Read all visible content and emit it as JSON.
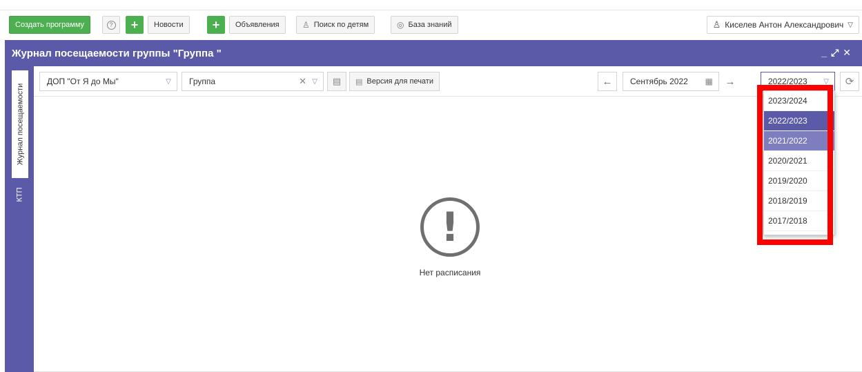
{
  "toolbar": {
    "create_program": "Создать программу",
    "help_icon": "?",
    "news": "Новости",
    "announcements": "Объявления",
    "child_search": "Поиск по детям",
    "knowledge_base": "База знаний",
    "user_name": "Киселев Антон Александрович"
  },
  "window": {
    "title": "Журнал посещаемости группы \"Группа \""
  },
  "sidebar": {
    "tabs": [
      "Журнал посещаемости",
      "КТП"
    ]
  },
  "filters": {
    "program": "ДОП \"От Я до Мы\"",
    "group": "Группа",
    "print_version": "Версия для печати",
    "month": "Сентябрь 2022",
    "year": "2022/2023"
  },
  "empty_state": {
    "message": "Нет расписания"
  },
  "year_dropdown": {
    "options": [
      "2023/2024",
      "2022/2023",
      "2021/2022",
      "2020/2021",
      "2019/2020",
      "2018/2019",
      "2017/2018"
    ],
    "selected": "2022/2023",
    "hovered": "2021/2022"
  },
  "colors": {
    "primary": "#5b5aa8",
    "green": "#4caf50",
    "highlight": "#ff0000"
  }
}
